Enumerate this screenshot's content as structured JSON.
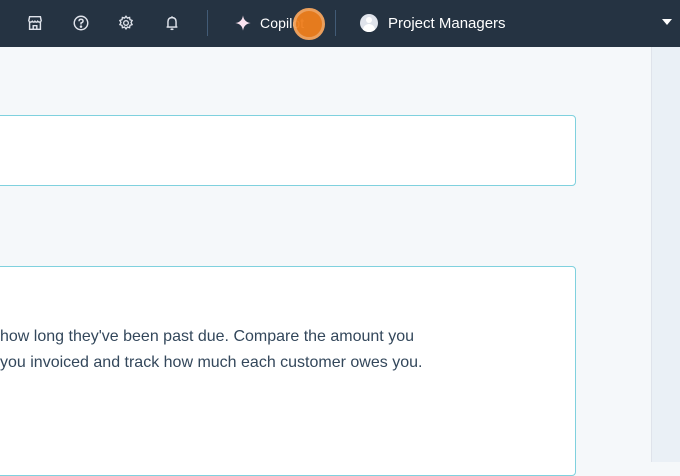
{
  "topbar": {
    "icons": [
      "marketplace-icon",
      "help-icon",
      "settings-icon",
      "notifications-icon",
      "copilot-sparkle-icon"
    ],
    "copilot_label": "Copilot",
    "account_label": "Project Managers"
  },
  "content": {
    "description_lines": [
      "how long they've been past due. Compare the amount you",
      " you invoiced and track how much each customer owes you."
    ]
  },
  "colors": {
    "topbar_bg": "#253342",
    "card_border": "#7fd1de",
    "click_marker": "#f07f1d"
  }
}
